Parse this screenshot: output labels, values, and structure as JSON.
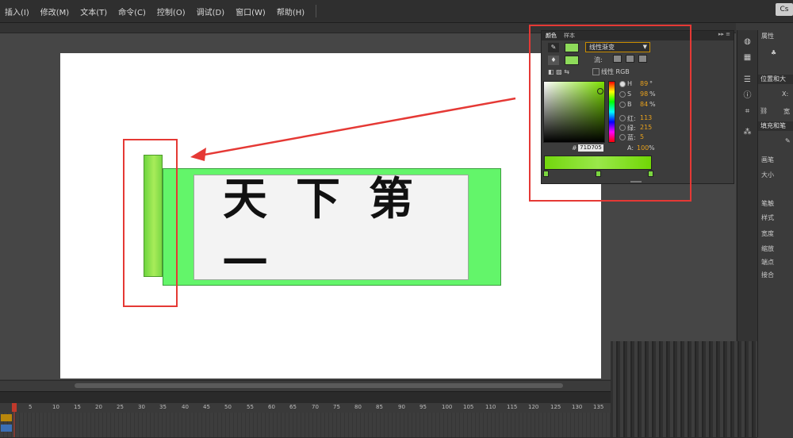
{
  "menubar": {
    "items": [
      "插入(I)",
      "修改(M)",
      "文本(T)",
      "命令(C)",
      "控制(O)",
      "调试(D)",
      "窗口(W)",
      "帮助(H)"
    ],
    "logo": "Cs"
  },
  "stage": {
    "scroll_text": "天下第一"
  },
  "color_panel": {
    "tabs": [
      "颜色",
      "样本"
    ],
    "menu": "▸▸ ≡",
    "fill_type": "线性渐变",
    "flow_label": "流:",
    "linear_rgb": "线性 RGB",
    "hsb": [
      {
        "label": "H",
        "value": "89",
        "unit": "°"
      },
      {
        "label": "S",
        "value": "98",
        "unit": "%"
      },
      {
        "label": "B",
        "value": "84",
        "unit": "%"
      }
    ],
    "rgb": [
      {
        "label": "红:",
        "value": "113"
      },
      {
        "label": "绿:",
        "value": "215"
      },
      {
        "label": "蓝:",
        "value": "5"
      }
    ],
    "hex_label": "#",
    "hex": "71D705",
    "alpha_label": "A:",
    "alpha": "100",
    "alpha_unit": "%",
    "stroke_color": "#8edb5a",
    "fill_color": "#8edb5a"
  },
  "properties": {
    "tab": "属性",
    "section_position": "位置和大",
    "x_label": "X:",
    "width_label": "宽",
    "section_fill": "填充和笔",
    "stroke_label": "画笔",
    "size_label": "大小",
    "blur_label": "笔触",
    "style_label": "样式",
    "width2_label": "宽度",
    "scale_label": "缩放",
    "cap_label": "端点",
    "join_label": "接合"
  },
  "timeline": {
    "ticks": [
      "1",
      "5",
      "10",
      "15",
      "20",
      "25",
      "30",
      "35",
      "40",
      "45",
      "50",
      "55",
      "60",
      "65",
      "70",
      "75",
      "80",
      "85",
      "90",
      "95",
      "100",
      "105",
      "110",
      "115",
      "120",
      "125",
      "130",
      "135"
    ]
  }
}
